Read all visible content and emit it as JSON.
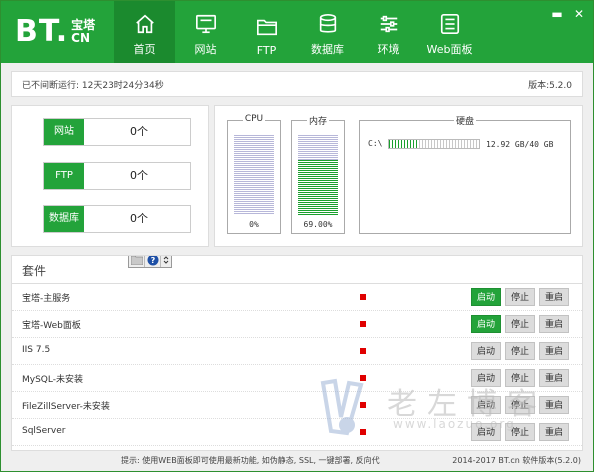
{
  "app": {
    "logo_main": "BT.",
    "logo_sub_top": "宝塔",
    "logo_sub_bottom": "CN"
  },
  "nav": [
    {
      "label": "首页",
      "icon": "home-icon",
      "active": true
    },
    {
      "label": "网站",
      "icon": "monitor-icon",
      "active": false
    },
    {
      "label": "FTP",
      "icon": "folder-icon",
      "active": false
    },
    {
      "label": "数据库",
      "icon": "database-icon",
      "active": false
    },
    {
      "label": "环境",
      "icon": "sliders-icon",
      "active": false
    },
    {
      "label": "Web面板",
      "icon": "panel-icon",
      "active": false
    }
  ],
  "window_controls": {
    "minimize": "▬",
    "close": "✕"
  },
  "status": {
    "uptime": "已不间断运行: 12天23时24分34秒",
    "version": "版本:5.2.0"
  },
  "stats": [
    {
      "label": "网站",
      "value": "0个"
    },
    {
      "label": "FTP",
      "value": "0个"
    },
    {
      "label": "数据库",
      "value": "0个"
    }
  ],
  "monitor": {
    "cpu": {
      "title": "CPU",
      "percent_text": "0%",
      "level": 0
    },
    "mem": {
      "title": "内存",
      "percent_text": "69.00%",
      "level": 0.69
    },
    "disk": {
      "title": "硬盘",
      "drive": "C:\\",
      "size": "12.92 GB/40 GB",
      "used_fraction": 0.323
    }
  },
  "suite": {
    "title": "套件",
    "services": [
      {
        "name": "宝塔-主服务",
        "start_active": true
      },
      {
        "name": "宝塔-Web面板",
        "start_active": true
      },
      {
        "name": "IIS 7.5",
        "start_active": false
      },
      {
        "name": "MySQL-未安装",
        "start_active": false
      },
      {
        "name": "FileZillServer-未安装",
        "start_active": false
      },
      {
        "name": "SqlServer",
        "start_active": false
      }
    ],
    "btn_start": "启动",
    "btn_stop": "停止",
    "btn_restart": "重启"
  },
  "footer": {
    "tip": "提示: 使用WEB面板即可使用最新功能, 如伪静态, SSL, 一键部署, 反向代",
    "version": "2014-2017 BT.cn  软件版本(5.2.0)"
  },
  "watermark": {
    "text": "老左博客",
    "url": "www.laozuo.org"
  },
  "colors": {
    "brand_green": "#23a33a",
    "status_red": "#e00000"
  }
}
